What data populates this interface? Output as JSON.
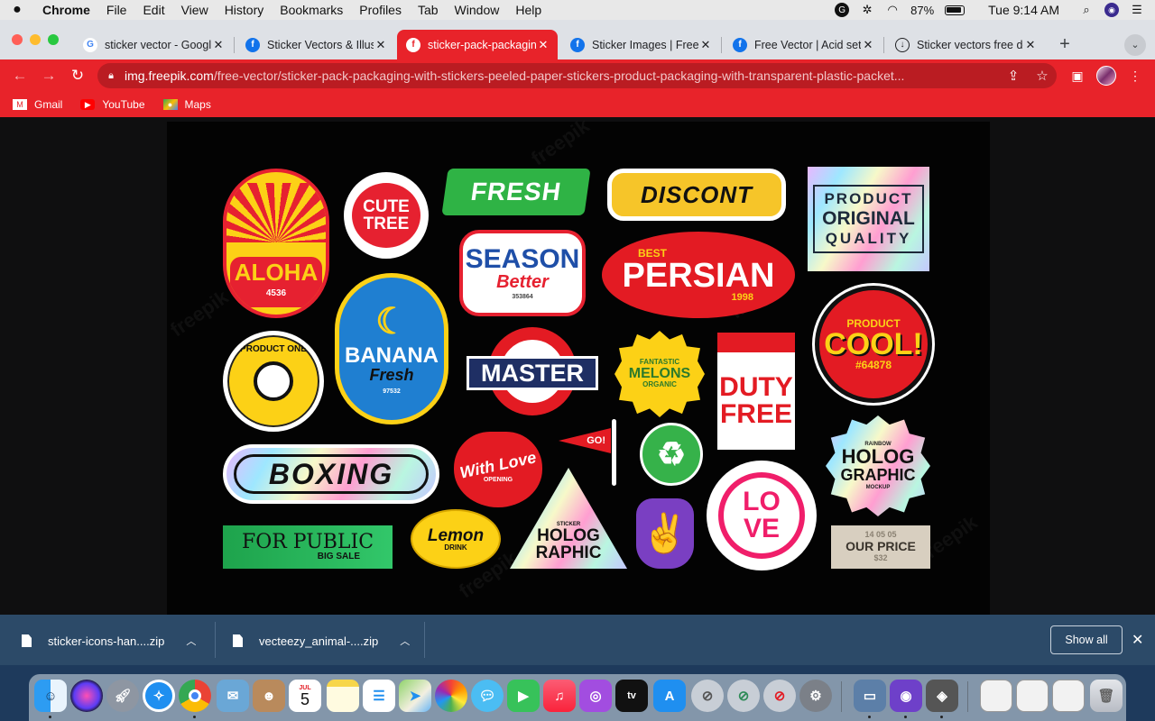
{
  "menubar": {
    "app": "Chrome",
    "items": [
      "File",
      "Edit",
      "View",
      "History",
      "Bookmarks",
      "Profiles",
      "Tab",
      "Window",
      "Help"
    ],
    "battery": "87%",
    "clock": "Tue 9:14 AM"
  },
  "tabs": [
    {
      "title": "sticker vector - Google Search",
      "favicon": "G"
    },
    {
      "title": "Sticker Vectors & Illustrations",
      "favicon": "f"
    },
    {
      "title": "sticker-pack-packaging",
      "favicon": "f"
    },
    {
      "title": "Sticker Images | Free Vectors",
      "favicon": "f"
    },
    {
      "title": "Free Vector | Acid set",
      "favicon": "f"
    },
    {
      "title": "Sticker vectors free download",
      "favicon": "↓"
    }
  ],
  "toolbar": {
    "url_host": "img.freepik.com",
    "url_path": "/free-vector/sticker-pack-packaging-with-stickers-peeled-paper-stickers-product-packaging-with-transparent-plastic-packet..."
  },
  "bookmarks": [
    {
      "label": "Gmail"
    },
    {
      "label": "YouTube"
    },
    {
      "label": "Maps"
    }
  ],
  "image": {
    "watermark": "freepik",
    "stickers": {
      "aloha": "ALOHA",
      "aloha_num": "4536",
      "cute": "CUTE",
      "tree": "TREE",
      "fresh": "FRESH",
      "discont": "DISCONT",
      "product_original_quality": [
        "PRODUCT",
        "ORIGINAL",
        "QUALITY"
      ],
      "season": "SEASON",
      "better": "Better",
      "season_num": "353864",
      "best": "BEST",
      "persian": "PERSIAN",
      "persian_year": "1998",
      "product_one": "PRODUCT ONE",
      "banana": "BANANA",
      "banana_fresh": "Fresh",
      "banana_num": "97532",
      "master": "MASTER",
      "fantastic": "FANTASTIC",
      "melons": "MELONS",
      "organic": "ORGANIC",
      "duty": "DUTY",
      "free": "FREE",
      "product_small": "PRODUCT",
      "cool": "COOL!",
      "cool_num": "#64878",
      "boxing": "BOXING",
      "with_love": "With Love",
      "opening": "OPENING",
      "go": "GO!",
      "rainbow": "RAINBOW",
      "holog": "HOLOG",
      "graphic": "GRAPHIC",
      "mockup": "MOCKUP",
      "for_public": "FOR PUBLIC",
      "big_sale": "BIG SALE",
      "lemon": "Lemon",
      "drink": "DRINK",
      "sticker": "STICKER",
      "holog2": "HOLOG",
      "raphic": "RAPHIC",
      "love": "LOVE",
      "our_price": "OUR PRICE",
      "price_top": "14 05 05",
      "price_bottom": "$32"
    }
  },
  "downloads": {
    "items": [
      "sticker-icons-han....zip",
      "vecteezy_animal-....zip"
    ],
    "show_all": "Show all"
  },
  "dock": {
    "calendar_day": "5",
    "calendar_month": "JUL"
  },
  "colors": {
    "brand_red": "#e8232a",
    "downloads_bar": "#2c4a68"
  }
}
